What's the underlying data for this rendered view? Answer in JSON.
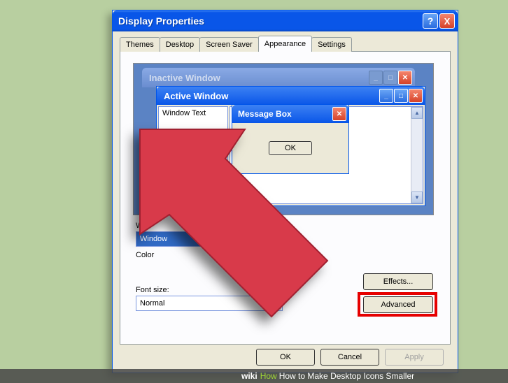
{
  "window": {
    "title": "Display Properties",
    "help": "?",
    "close": "X"
  },
  "tabs": [
    "Themes",
    "Desktop",
    "Screen Saver",
    "Appearance",
    "Settings"
  ],
  "active_tab_index": 3,
  "preview": {
    "inactive_title": "Inactive Window",
    "active_title": "Active Window",
    "window_text": "Window Text",
    "msgbox_title": "Message Box",
    "msgbox_ok": "OK"
  },
  "fields": {
    "scheme_label": "W",
    "scheme_value": "Window",
    "color_label": "Color",
    "font_label": "Font size:",
    "font_value": "Normal"
  },
  "buttons": {
    "effects": "Effects...",
    "advanced": "Advanced",
    "ok": "OK",
    "cancel": "Cancel",
    "apply": "Apply"
  },
  "caption": {
    "wiki": "wiki",
    "how": "How",
    "title": "How to Make Desktop Icons Smaller"
  },
  "icons": {
    "min": "_",
    "max": "□",
    "close": "✕",
    "up": "▲",
    "down": "▼",
    "dropdown": "▾"
  }
}
